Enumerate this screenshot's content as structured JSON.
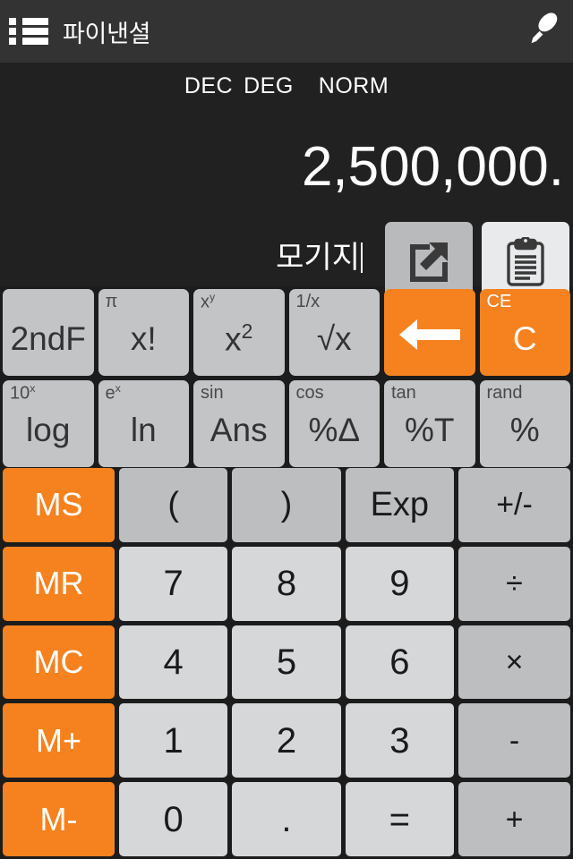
{
  "appbar": {
    "menu_icon": "list-menu-icon",
    "title": "파이낸셜",
    "pen_icon": "highlighter-pen-icon"
  },
  "display": {
    "modes": [
      "DEC",
      "DEG",
      "NORM"
    ],
    "value": "2,500,000.",
    "sub_label": "모기지",
    "share_button": "share-external-link-icon",
    "paste_button": "clipboard-paste-icon",
    "colors": {
      "background": "#212121",
      "text": "#ffffff"
    }
  },
  "function_keys": [
    {
      "secondary": "",
      "primary": "2ndF",
      "sup": "",
      "style": "gray"
    },
    {
      "secondary": "π",
      "primary": "x!",
      "sup": "",
      "style": "gray"
    },
    {
      "secondary": "x",
      "sec_sup": "y",
      "primary": "x",
      "sup": "2",
      "style": "gray"
    },
    {
      "secondary": "1/x",
      "primary": "√x",
      "sup": "",
      "style": "gray"
    },
    {
      "secondary": "",
      "primary": "←",
      "sup": "",
      "style": "orange",
      "name": "backspace"
    },
    {
      "secondary": "CE",
      "primary": "C",
      "sup": "",
      "style": "orange"
    },
    {
      "secondary": "10",
      "sec_sup": "x",
      "primary": "log",
      "sup": "",
      "style": "gray"
    },
    {
      "secondary": "e",
      "sec_sup": "x",
      "primary": "ln",
      "sup": "",
      "style": "gray"
    },
    {
      "secondary": "sin",
      "primary": "Ans",
      "sup": "",
      "style": "gray"
    },
    {
      "secondary": "cos",
      "primary": "%Δ",
      "sup": "",
      "style": "gray"
    },
    {
      "secondary": "tan",
      "primary": "%T",
      "sup": "",
      "style": "gray"
    },
    {
      "secondary": "rand",
      "primary": "%",
      "sup": "",
      "style": "gray"
    }
  ],
  "keypad": [
    {
      "label": "MS",
      "style": "mem"
    },
    {
      "label": "(",
      "style": "paren"
    },
    {
      "label": ")",
      "style": "paren"
    },
    {
      "label": "Exp",
      "style": "paren"
    },
    {
      "label": "+/-",
      "style": "op"
    },
    {
      "label": "MR",
      "style": "mem"
    },
    {
      "label": "7",
      "style": "num"
    },
    {
      "label": "8",
      "style": "num"
    },
    {
      "label": "9",
      "style": "num"
    },
    {
      "label": "÷",
      "style": "op"
    },
    {
      "label": "MC",
      "style": "mem"
    },
    {
      "label": "4",
      "style": "num"
    },
    {
      "label": "5",
      "style": "num"
    },
    {
      "label": "6",
      "style": "num"
    },
    {
      "label": "×",
      "style": "op"
    },
    {
      "label": "M+",
      "style": "mem"
    },
    {
      "label": "1",
      "style": "num"
    },
    {
      "label": "2",
      "style": "num"
    },
    {
      "label": "3",
      "style": "num"
    },
    {
      "label": "-",
      "style": "op"
    },
    {
      "label": "M-",
      "style": "mem"
    },
    {
      "label": "0",
      "style": "num"
    },
    {
      "label": ".",
      "style": "dot"
    },
    {
      "label": "=",
      "style": "num"
    },
    {
      "label": "+",
      "style": "op"
    }
  ],
  "colors": {
    "orange": "#f5821f",
    "number_key": "#d6d7d9",
    "operator_key": "#bcbec0",
    "function_key": "#c3c4c6",
    "appbar": "#333333",
    "body": "#1c1c1c"
  }
}
